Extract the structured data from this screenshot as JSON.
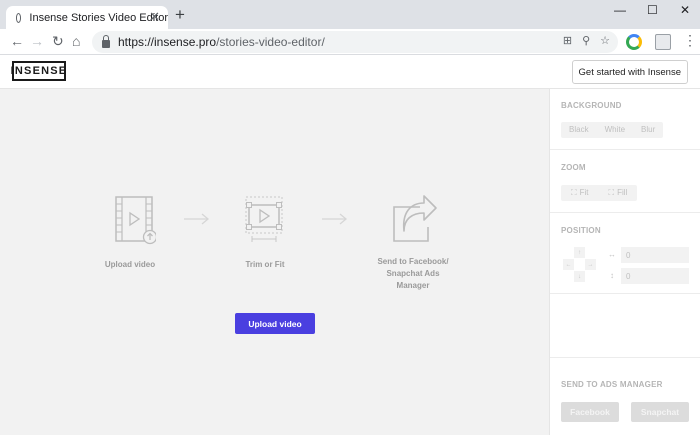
{
  "browser": {
    "tab_title": "Insense Stories Video Editor",
    "tab_close": "✕",
    "new_tab": "+",
    "minimize": "—",
    "maximize": "☐",
    "close": "✕",
    "url_host": "https://insense.pro",
    "url_path": "/stories-video-editor/"
  },
  "header": {
    "logo": "INSENSE",
    "cta": "Get started with Insense"
  },
  "steps": [
    {
      "label": "Upload video"
    },
    {
      "label": "Trim or Fit"
    },
    {
      "label_line1": "Send to Facebook/",
      "label_line2": "Snapchat Ads",
      "label_line3": "Manager"
    }
  ],
  "main": {
    "upload_button": "Upload video"
  },
  "sidebar": {
    "background": {
      "title": "BACKGROUND",
      "options": [
        "Black",
        "White",
        "Blur"
      ]
    },
    "zoom": {
      "title": "ZOOM",
      "options": [
        "Fit",
        "Fill"
      ]
    },
    "position": {
      "title": "POSITION",
      "x_value": "0",
      "y_value": "0",
      "x_icon": "↔",
      "y_icon": "↕"
    },
    "ads": {
      "title": "SEND TO ADS MANAGER",
      "facebook": "Facebook",
      "snapchat": "Snapchat"
    }
  }
}
